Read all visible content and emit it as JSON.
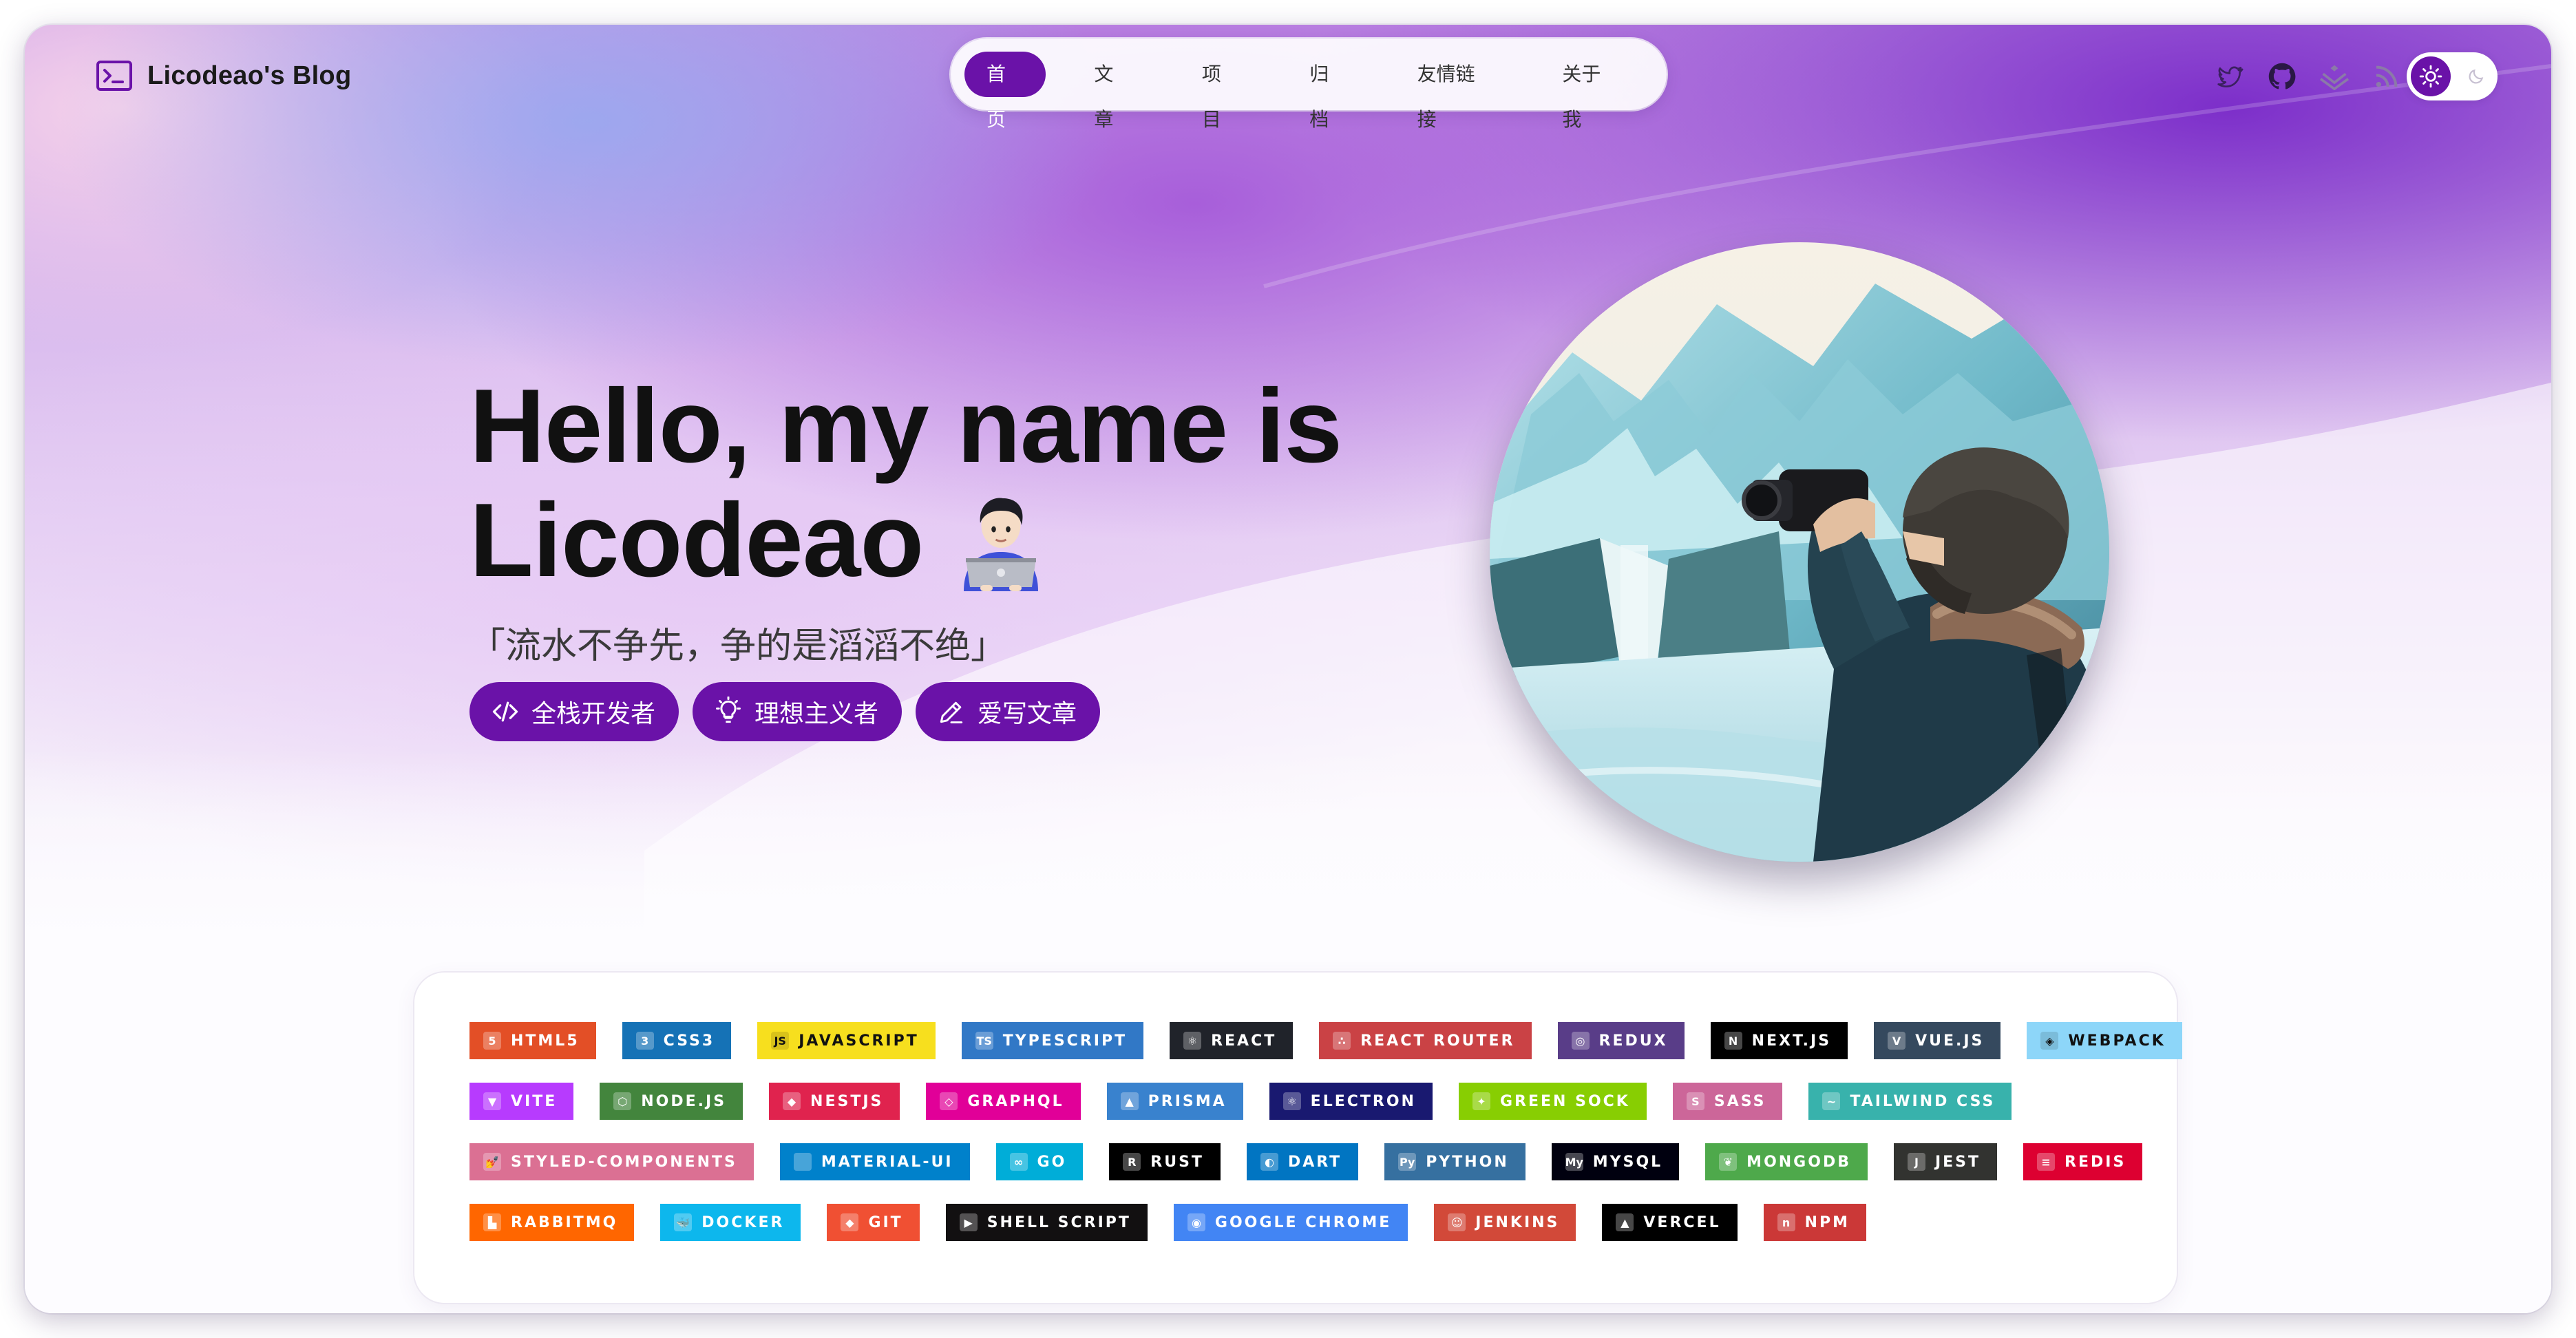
{
  "site": {
    "brand_title": "Licodeao's Blog"
  },
  "nav": {
    "items": [
      {
        "label": "首页",
        "active": true
      },
      {
        "label": "文章",
        "active": false
      },
      {
        "label": "项目",
        "active": false
      },
      {
        "label": "归档",
        "active": false
      },
      {
        "label": "友情链接",
        "active": false
      },
      {
        "label": "关于我",
        "active": false
      }
    ]
  },
  "header_icons": [
    "twitter-icon",
    "github-icon",
    "juejin-icon",
    "rss-icon"
  ],
  "theme_toggle": {
    "state": "light",
    "icons": [
      "sun-icon",
      "moon-icon"
    ]
  },
  "hero": {
    "title_line1": "Hello, my name is",
    "title_line2": "Licodeao",
    "emoji": "technologist-emoji",
    "motto": "「流水不争先，争的是滔滔不绝」",
    "tags": [
      {
        "label": "全栈开发者",
        "icon": "code-icon"
      },
      {
        "label": "理想主义者",
        "icon": "lightbulb-icon"
      },
      {
        "label": "爱写文章",
        "icon": "pencil-icon"
      }
    ]
  },
  "skills": {
    "rows": [
      [
        {
          "label": "HTML5",
          "color": "#e34f26",
          "glyph": "5"
        },
        {
          "label": "CSS3",
          "color": "#1572b6",
          "glyph": "3"
        },
        {
          "label": "JAVASCRIPT",
          "color": "#f7df1e",
          "glyph": "JS",
          "dark": true
        },
        {
          "label": "TYPESCRIPT",
          "color": "#3178c6",
          "glyph": "TS"
        },
        {
          "label": "REACT",
          "color": "#20232a",
          "glyph": "⚛"
        },
        {
          "label": "REACT ROUTER",
          "color": "#ca4245",
          "glyph": "∴"
        },
        {
          "label": "REDUX",
          "color": "#593d88",
          "glyph": "◎"
        },
        {
          "label": "NEXT.JS",
          "color": "#000000",
          "glyph": "N"
        },
        {
          "label": "VUE.JS",
          "color": "#35495e",
          "glyph": "V"
        },
        {
          "label": "WEBPACK",
          "color": "#8dd6f9",
          "glyph": "◈",
          "dark": true
        }
      ],
      [
        {
          "label": "VITE",
          "color": "#b73bfe",
          "glyph": "▼"
        },
        {
          "label": "NODE.JS",
          "color": "#43853d",
          "glyph": "⬡"
        },
        {
          "label": "NESTJS",
          "color": "#e0234e",
          "glyph": "◆"
        },
        {
          "label": "GRAPHQL",
          "color": "#e10098",
          "glyph": "◇"
        },
        {
          "label": "PRISMA",
          "color": "#3982ce",
          "glyph": "▲"
        },
        {
          "label": "ELECTRON",
          "color": "#191970",
          "glyph": "⚛"
        },
        {
          "label": "GREEN SOCK",
          "color": "#88ce02",
          "glyph": "✦"
        },
        {
          "label": "SASS",
          "color": "#cc6699",
          "glyph": "S"
        },
        {
          "label": "TAILWIND CSS",
          "color": "#38b2ac",
          "glyph": "~"
        }
      ],
      [
        {
          "label": "STYLED-COMPONENTS",
          "color": "#db7093",
          "glyph": "💅"
        },
        {
          "label": "MATERIAL-UI",
          "color": "#0081cb",
          "glyph": ""
        },
        {
          "label": "GO",
          "color": "#00add8",
          "glyph": "∞"
        },
        {
          "label": "RUST",
          "color": "#000000",
          "glyph": "R"
        },
        {
          "label": "DART",
          "color": "#0175c2",
          "glyph": "◐"
        },
        {
          "label": "PYTHON",
          "color": "#3670a0",
          "glyph": "Py"
        },
        {
          "label": "MYSQL",
          "color": "#00000f",
          "glyph": "My"
        },
        {
          "label": "MONGODB",
          "color": "#4ea94b",
          "glyph": "❦"
        },
        {
          "label": "JEST",
          "color": "#323330",
          "glyph": "J"
        },
        {
          "label": "REDIS",
          "color": "#dd0031",
          "glyph": "≡"
        }
      ],
      [
        {
          "label": "RABBITMQ",
          "color": "#ff6600",
          "glyph": "▙"
        },
        {
          "label": "DOCKER",
          "color": "#0db7ed",
          "glyph": "🐳"
        },
        {
          "label": "GIT",
          "color": "#f05033",
          "glyph": "◆"
        },
        {
          "label": "SHELL SCRIPT",
          "color": "#121011",
          "glyph": "▶"
        },
        {
          "label": "GOOGLE CHROME",
          "color": "#4285f4",
          "glyph": "◉"
        },
        {
          "label": "JENKINS",
          "color": "#d24939",
          "glyph": "☺"
        },
        {
          "label": "VERCEL",
          "color": "#000000",
          "glyph": "▲"
        },
        {
          "label": "NPM",
          "color": "#cb3837",
          "glyph": "n"
        }
      ]
    ]
  },
  "colors": {
    "accent": "#6a12a8",
    "text": "#111111"
  }
}
